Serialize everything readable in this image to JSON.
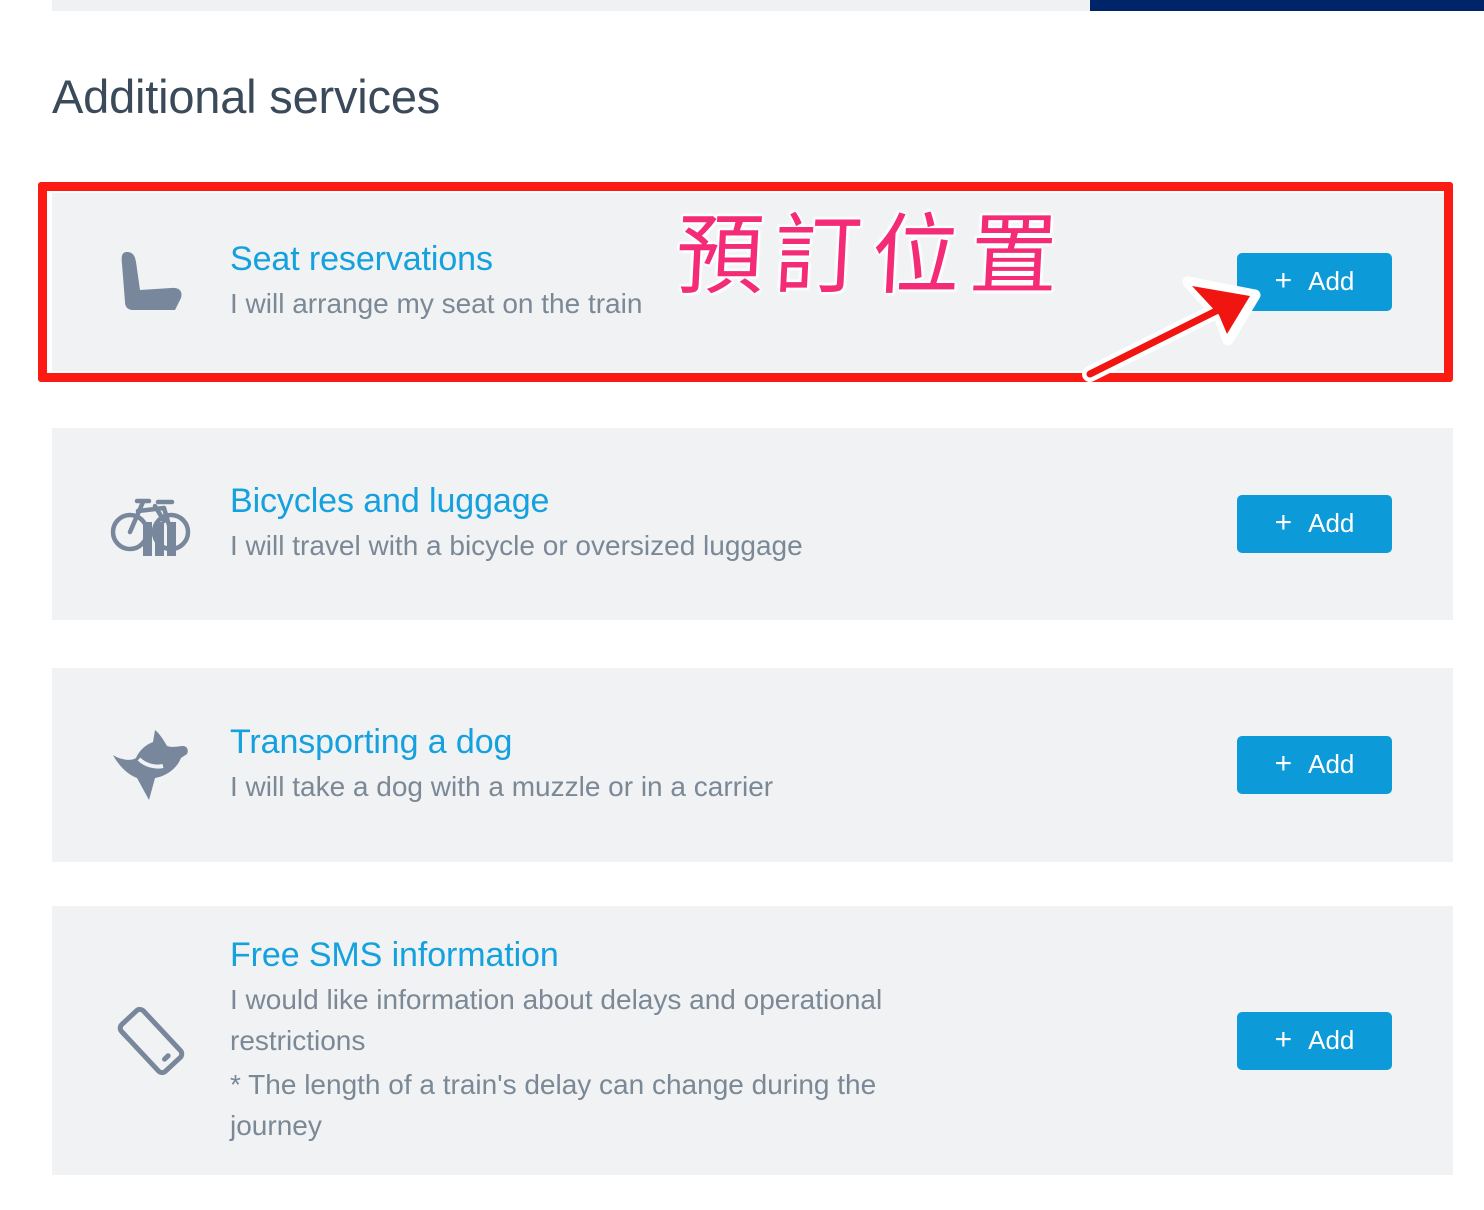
{
  "top_chrome": {
    "grey_strip": "",
    "navy_strip": ""
  },
  "page": {
    "title": "Additional services"
  },
  "colors": {
    "card_background": "#f0f2f4",
    "title_link": "#14a1de",
    "description_text": "#7b8896",
    "heading_text": "#3b4a5a",
    "button_background": "#0c9ad8",
    "button_text": "#ffffff",
    "annotation_red": "#fc1b12",
    "annotation_pink": "#f42b77",
    "navy_bar": "#00246a",
    "icon_grey": "#78879b"
  },
  "services": [
    {
      "icon": "seat-icon",
      "title": "Seat reservations",
      "description": "I will arrange my seat on the train",
      "note": "",
      "button": {
        "plus": "+",
        "label": "Add"
      }
    },
    {
      "icon": "bicycle-luggage-icon",
      "title": "Bicycles and luggage",
      "description": "I will travel with a bicycle or oversized luggage",
      "note": "",
      "button": {
        "plus": "+",
        "label": "Add"
      }
    },
    {
      "icon": "dog-icon",
      "title": "Transporting a dog",
      "description": "I will take a dog with a muzzle or in a carrier",
      "note": "",
      "button": {
        "plus": "+",
        "label": "Add"
      }
    },
    {
      "icon": "mobile-phone-icon",
      "title": "Free SMS information",
      "description": "I would like information about delays and operational restrictions",
      "note": "* The length of a train's delay can change during the journey",
      "button": {
        "plus": "+",
        "label": "Add"
      }
    }
  ],
  "annotations": {
    "highlight_target": "Seat reservations",
    "handwritten_text": "預訂位置",
    "arrow": "arrow pointing to the Add button of the Seat reservations row"
  }
}
